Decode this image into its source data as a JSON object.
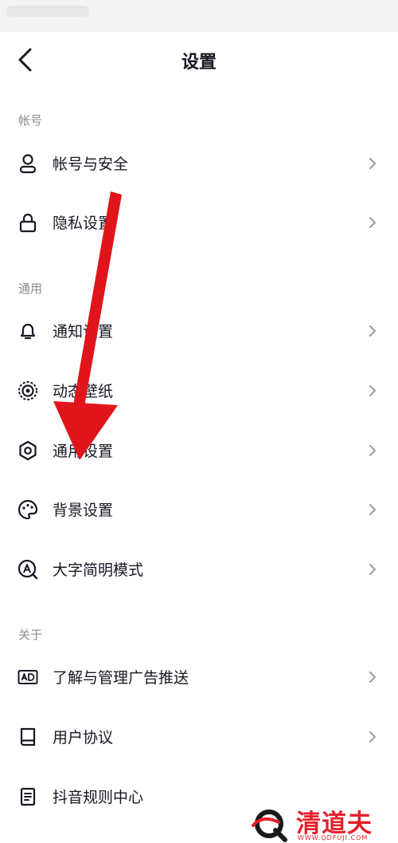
{
  "header": {
    "title": "设置"
  },
  "sections": {
    "account": "帐号",
    "general": "通用",
    "about": "关于"
  },
  "rows": {
    "account_security": "帐号与安全",
    "privacy": "隐私设置",
    "notification": "通知设置",
    "wallpaper": "动态壁纸",
    "general_settings": "通用设置",
    "background": "背景设置",
    "large_text": "大字简明模式",
    "ads": "了解与管理广告推送",
    "user_agreement": "用户协议",
    "rules_center": "抖音规则中心"
  },
  "icons": {
    "account_security": "user-icon",
    "privacy": "lock-icon",
    "notification": "bell-icon",
    "wallpaper": "wallpaper-icon",
    "general_settings": "gear-icon",
    "background": "palette-icon",
    "large_text": "text-size-icon",
    "ads": "ad-icon",
    "user_agreement": "book-icon",
    "rules_center": "document-icon"
  },
  "annotation": {
    "arrow_color": "#e0151b"
  },
  "watermark": {
    "brand": "清道夫",
    "url": "WWW.QDFUJI.COM",
    "color": "#e5202b"
  }
}
